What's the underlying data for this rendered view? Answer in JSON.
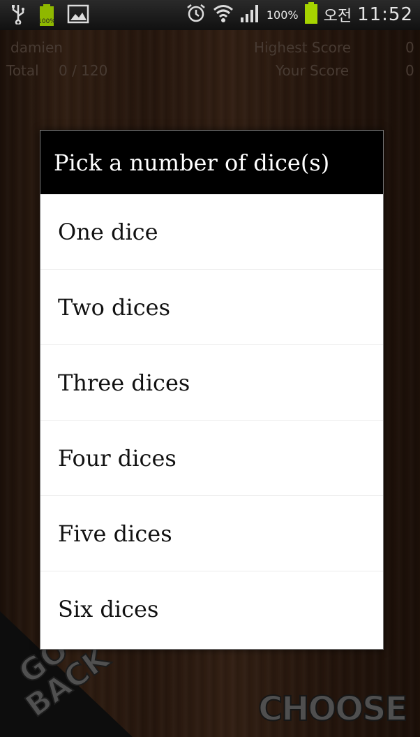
{
  "status_bar": {
    "battery_small_label": "100%",
    "battery_percent": "100%",
    "korean_label": "오전",
    "time": "11:52",
    "icons": [
      "usb-icon",
      "battery-icon",
      "image-icon",
      "alarm-icon",
      "wifi-icon",
      "signal-icon",
      "battery-icon"
    ],
    "battery_color": "#a6d400"
  },
  "score_panel": {
    "player_name": "damien",
    "total_label": "Total",
    "total_value": "0 / 120",
    "highest_score_label": "Highest Score",
    "highest_score_value": "0",
    "your_score_label": "Your Score",
    "your_score_value": "0"
  },
  "dialog": {
    "title": "Pick a number of dice(s)",
    "options": [
      {
        "label": "One dice"
      },
      {
        "label": "Two dices"
      },
      {
        "label": "Three dices"
      },
      {
        "label": "Four dices"
      },
      {
        "label": "Five dices"
      },
      {
        "label": "Six dices"
      }
    ]
  },
  "bottom_buttons": {
    "go_back_line1": "GO",
    "go_back_line2": "BACK",
    "choose": "CHOOSE"
  }
}
